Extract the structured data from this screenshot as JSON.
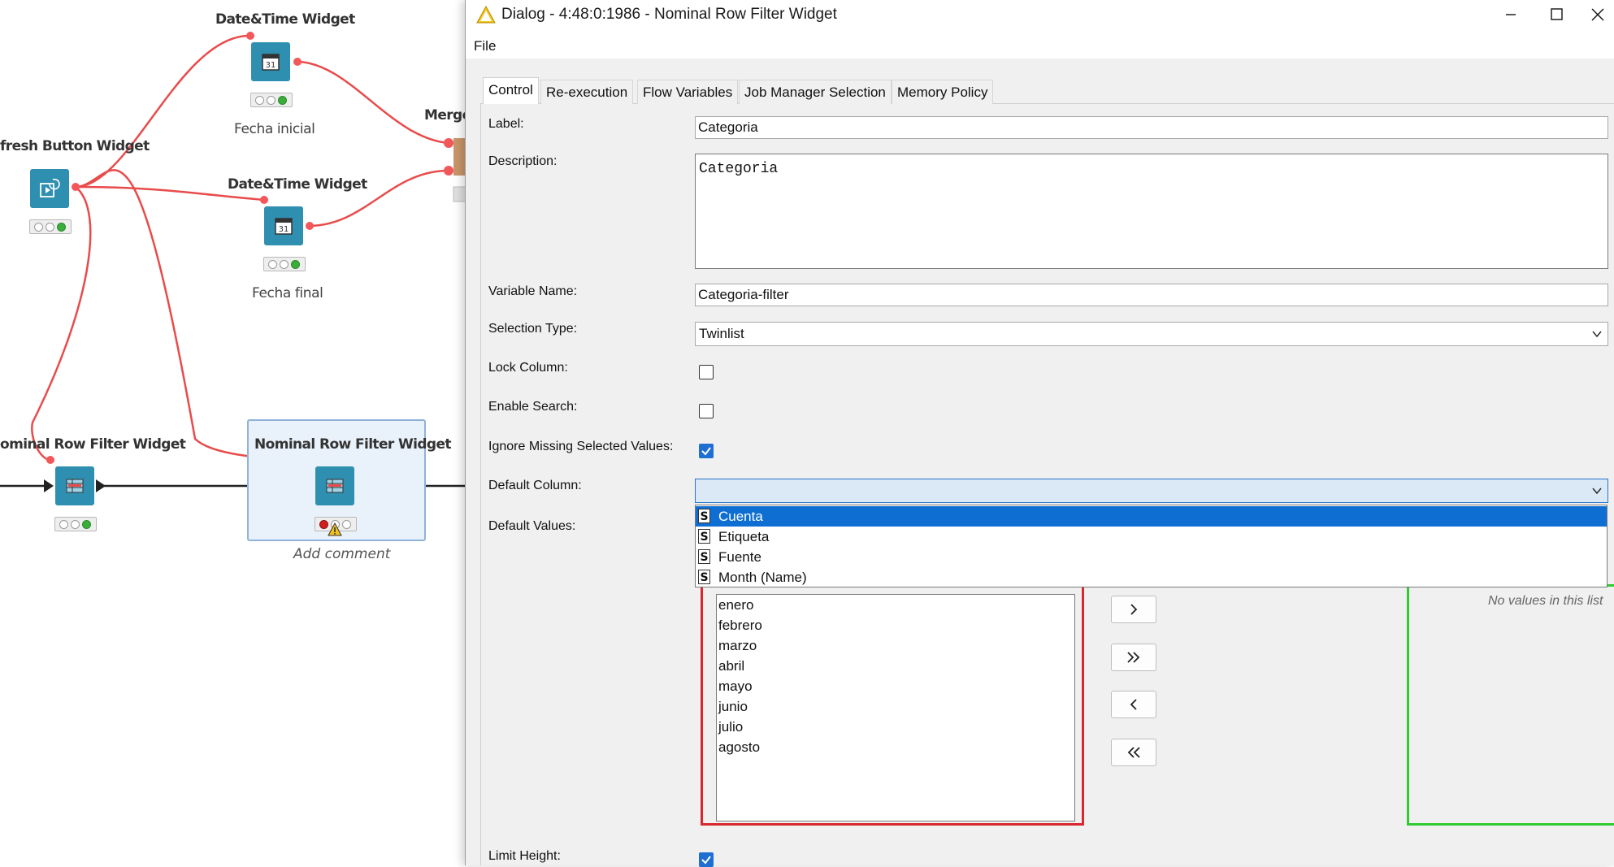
{
  "workflow": {
    "nodes": {
      "datetime1": {
        "title": "Date&Time Widget",
        "label": "Fecha inicial"
      },
      "refresh": {
        "title": "fresh Button Widget"
      },
      "datetime2": {
        "title": "Date&Time Widget",
        "label": "Fecha final"
      },
      "merge": {
        "title": "Merge"
      },
      "nominal1": {
        "title": "ominal Row Filter Widget"
      },
      "nominal2": {
        "title": "Nominal Row Filter Widget",
        "comment": "Add comment"
      }
    },
    "colors": {
      "wire": "#e94b4b",
      "node": "#2f8fb0",
      "port": "#f2575a"
    }
  },
  "dialog": {
    "title": "Dialog - 4:48:0:1986 - Nominal Row Filter Widget",
    "menu": {
      "file": "File"
    },
    "tabs": [
      "Control",
      "Re-execution",
      "Flow Variables",
      "Job Manager Selection",
      "Memory Policy"
    ],
    "active_tab": "Control",
    "fields": {
      "label": {
        "caption": "Label:",
        "value": "Categoria"
      },
      "description": {
        "caption": "Description:",
        "value": "Categoria"
      },
      "variable_name": {
        "caption": "Variable Name:",
        "value": "Categoria-filter"
      },
      "selection_type": {
        "caption": "Selection Type:",
        "value": "Twinlist"
      },
      "lock_column": {
        "caption": "Lock Column:",
        "checked": false
      },
      "enable_search": {
        "caption": "Enable Search:",
        "checked": false
      },
      "ignore_missing": {
        "caption": "Ignore Missing Selected Values:",
        "checked": true
      },
      "default_column": {
        "caption": "Default Column:",
        "value": ""
      },
      "default_values": {
        "caption": "Default Values:"
      },
      "limit_height": {
        "caption": "Limit Height:",
        "checked": true
      }
    },
    "default_column_options": [
      {
        "type": "S",
        "name": "Cuenta",
        "selected": true
      },
      {
        "type": "S",
        "name": "Etiqueta",
        "selected": false
      },
      {
        "type": "S",
        "name": "Fuente",
        "selected": false
      },
      {
        "type": "S",
        "name": "Month (Name)",
        "selected": false
      }
    ],
    "twinlist": {
      "available": [
        "enero",
        "febrero",
        "marzo",
        "abril",
        "mayo",
        "junio",
        "julio",
        "agosto"
      ],
      "selected_empty_text": "No values in this list",
      "buttons": [
        "add",
        "add-all",
        "remove",
        "remove-all"
      ],
      "left_highlight_color": "#d9262f",
      "right_highlight_color": "#2fcb2f"
    }
  }
}
